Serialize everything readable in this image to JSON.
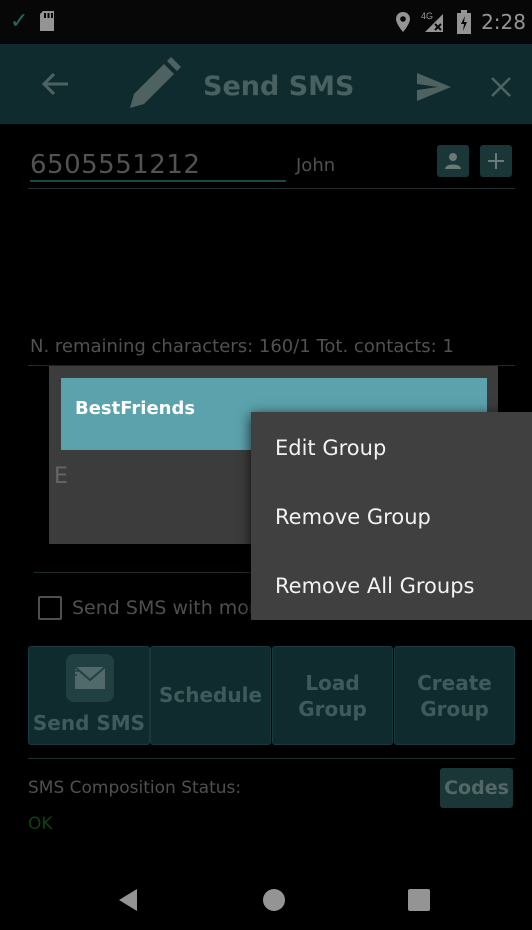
{
  "status_bar": {
    "time": "2:28",
    "network": "4G"
  },
  "toolbar": {
    "title": "Send SMS"
  },
  "recipient": {
    "phone": "6505551212",
    "name": "John"
  },
  "counter_text": "N. remaining characters:  160/1   Tot. contacts:  1",
  "dialog": {
    "group_name": "BestFriends",
    "partial_label": "E"
  },
  "context_menu": [
    "Edit Group",
    "Remove Group",
    "Remove All Groups"
  ],
  "checkbox_label": "Send SMS with mor",
  "buttons": {
    "send": "Send SMS",
    "schedule": "Schedule",
    "load_line1": "Load",
    "load_line2": "Group",
    "create_line1": "Create",
    "create_line2": "Group"
  },
  "status": {
    "label": "SMS Composition Status:",
    "value": "OK",
    "codes": "Codes"
  },
  "colors": {
    "toolbar": "#1d4a4e",
    "accent": "#5ba2ac",
    "ok": "#1e6e1e"
  }
}
